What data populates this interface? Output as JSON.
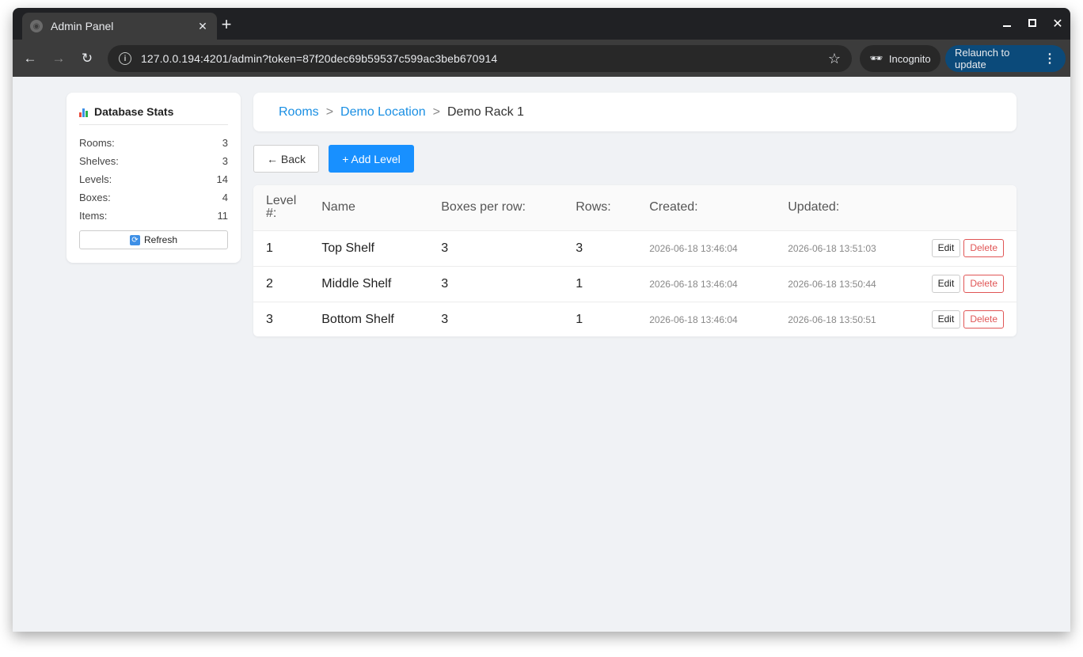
{
  "browser": {
    "tab_title": "Admin Panel",
    "url": "127.0.0.194:4201/admin?token=87f20dec69b59537c599ac3beb670914",
    "incognito_label": "Incognito",
    "relaunch_label": "Relaunch to update"
  },
  "stats": {
    "title": "Database Stats",
    "rows": [
      {
        "label": "Rooms:",
        "value": "3"
      },
      {
        "label": "Shelves:",
        "value": "3"
      },
      {
        "label": "Levels:",
        "value": "14"
      },
      {
        "label": "Boxes:",
        "value": "4"
      },
      {
        "label": "Items:",
        "value": "11"
      }
    ],
    "refresh_label": "Refresh"
  },
  "breadcrumb": {
    "items": [
      "Rooms",
      "Demo Location"
    ],
    "separator": ">",
    "current": "Demo Rack 1"
  },
  "actions": {
    "back_label": "← Back",
    "add_label": "+ Add Level"
  },
  "table": {
    "headers": [
      "Level #:",
      "Name",
      "Boxes per row:",
      "Rows:",
      "Created:",
      "Updated:"
    ],
    "edit_label": "Edit",
    "delete_label": "Delete",
    "rows": [
      {
        "level": "1",
        "name": "Top Shelf",
        "boxes_per_row": "3",
        "rows": "3",
        "created": "2026-06-18 13:46:04",
        "updated": "2026-06-18 13:51:03"
      },
      {
        "level": "2",
        "name": "Middle Shelf",
        "boxes_per_row": "3",
        "rows": "1",
        "created": "2026-06-18 13:46:04",
        "updated": "2026-06-18 13:50:44"
      },
      {
        "level": "3",
        "name": "Bottom Shelf",
        "boxes_per_row": "3",
        "rows": "1",
        "created": "2026-06-18 13:46:04",
        "updated": "2026-06-18 13:50:51"
      }
    ]
  },
  "colors": {
    "accent": "#1890ff",
    "link": "#1a8fe3",
    "danger": "#e05555",
    "page_bg": "#f0f2f5"
  }
}
